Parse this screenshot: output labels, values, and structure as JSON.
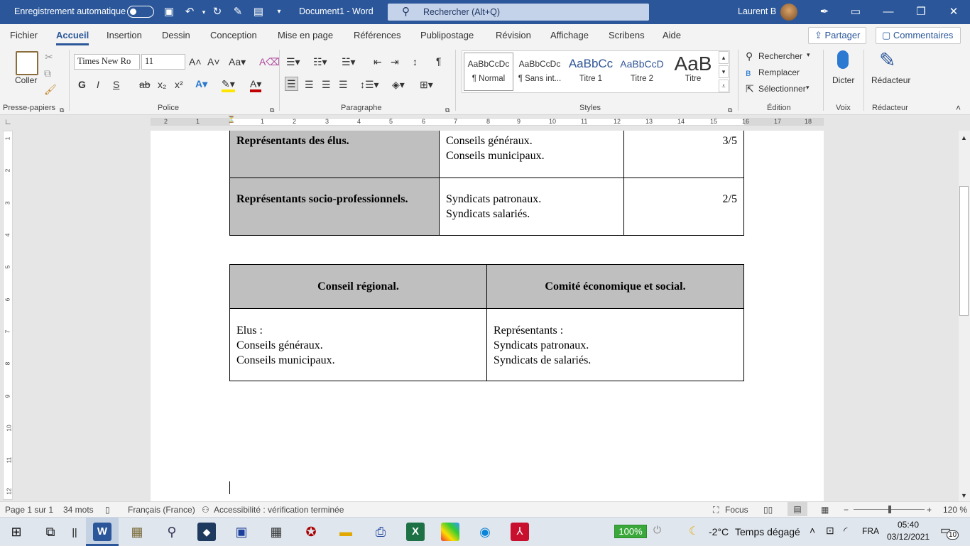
{
  "titlebar": {
    "autosave_label": "Enregistrement automatique",
    "document_title": "Document1 - Word",
    "search_placeholder": "Rechercher (Alt+Q)",
    "user_name": "Laurent B"
  },
  "tabs": [
    "Fichier",
    "Accueil",
    "Insertion",
    "Dessin",
    "Conception",
    "Mise en page",
    "Références",
    "Publipostage",
    "Révision",
    "Affichage",
    "Scribens",
    "Aide"
  ],
  "share_label": "Partager",
  "comments_label": "Commentaires",
  "ribbon": {
    "clipboard": {
      "paste_label": "Coller",
      "group_label": "Presse-papiers"
    },
    "font": {
      "font_name": "Times New Ro",
      "font_size": "11",
      "group_label": "Police",
      "bold": "G",
      "italic": "I",
      "underline": "S",
      "strike": "ab",
      "subscript": "x₂",
      "superscript": "x²"
    },
    "paragraph": {
      "group_label": "Paragraphe"
    },
    "styles": {
      "group_label": "Styles",
      "items": [
        {
          "preview": "AaBbCcDc",
          "name": "¶ Normal"
        },
        {
          "preview": "AaBbCcDc",
          "name": "¶ Sans int..."
        },
        {
          "preview": "AaBbCc",
          "name": "Titre 1"
        },
        {
          "preview": "AaBbCcD",
          "name": "Titre 2"
        },
        {
          "preview": "AaB",
          "name": "Titre"
        }
      ]
    },
    "editing": {
      "group_label": "Édition",
      "find": "Rechercher",
      "replace": "Remplacer",
      "select": "Sélectionner"
    },
    "voice": {
      "group_label": "Voix",
      "dictate": "Dicter"
    },
    "editor": {
      "group_label": "Rédacteur",
      "editor": "Rédacteur"
    }
  },
  "ruler": {
    "h_labels": [
      "2",
      "1",
      "1",
      "2",
      "3",
      "4",
      "5",
      "6",
      "7",
      "8",
      "9",
      "10",
      "11",
      "12",
      "13",
      "14",
      "15",
      "16",
      "17",
      "18"
    ],
    "v_labels": [
      "1",
      "2",
      "3",
      "4",
      "5",
      "6",
      "7",
      "8",
      "9",
      "10",
      "11",
      "12"
    ]
  },
  "document": {
    "table1": [
      {
        "label": "Représentants des élus.",
        "lines": [
          "Conseils généraux.",
          "Conseils municipaux."
        ],
        "value": "3/5"
      },
      {
        "label": "Représentants socio-professionnels.",
        "lines": [
          "Syndicats patronaux.",
          "Syndicats salariés."
        ],
        "value": "2/5"
      }
    ],
    "table2": {
      "headers": [
        "Conseil régional.",
        "Comité économique et social."
      ],
      "col1": [
        "Elus :",
        "Conseils généraux.",
        "Conseils municipaux."
      ],
      "col2": [
        "Représentants :",
        "Syndicats patronaux.",
        "Syndicats de salariés."
      ]
    }
  },
  "status": {
    "page": "Page 1 sur 1",
    "words": "34 mots",
    "language": "Français (France)",
    "accessibility": "Accessibilité : vérification terminée",
    "focus": "Focus",
    "zoom": "120 %"
  },
  "taskbar": {
    "battery": "100%",
    "weather_temp": "-2°C",
    "weather_text": "Temps dégagé",
    "lang": "FRA",
    "time": "05:40",
    "date": "03/12/2021",
    "notifications": "10"
  },
  "colors": {
    "word_blue": "#2b579a",
    "table_grey": "#bfbfbf"
  }
}
